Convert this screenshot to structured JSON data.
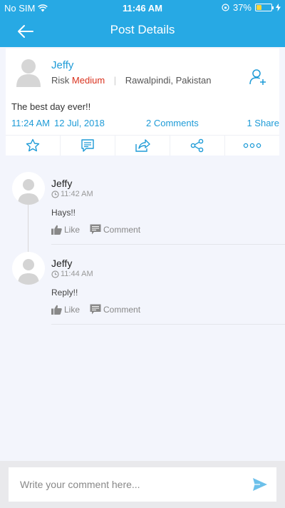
{
  "status_bar": {
    "carrier": "No SIM",
    "time": "11:46 AM",
    "battery": "37%",
    "battery_level": 0.37
  },
  "navbar": {
    "title": "Post Details"
  },
  "post": {
    "author": "Jeffy",
    "risk_label": "Risk",
    "risk_value": "Medium",
    "location": "Rawalpindi, Pakistan",
    "text": "The best day ever!!",
    "time": "11:24 AM",
    "date": "12 Jul, 2018",
    "comments": "2 Comments",
    "shares": "1 Share"
  },
  "actions": [
    "star-icon",
    "comment-icon",
    "forward-icon",
    "share-icon",
    "more-icon"
  ],
  "comments": [
    {
      "author": "Jeffy",
      "time": "11:42 AM",
      "text": "Hays!!",
      "like_label": "Like",
      "comment_label": "Comment"
    },
    {
      "author": "Jeffy",
      "time": "11:44 AM",
      "text": "Reply!!",
      "like_label": "Like",
      "comment_label": "Comment"
    }
  ],
  "input": {
    "placeholder": "Write your comment here..."
  },
  "colors": {
    "primary": "#27a9e4",
    "link": "#1e9bd7",
    "risk": "#d9321e",
    "background": "#f3f5fc"
  }
}
